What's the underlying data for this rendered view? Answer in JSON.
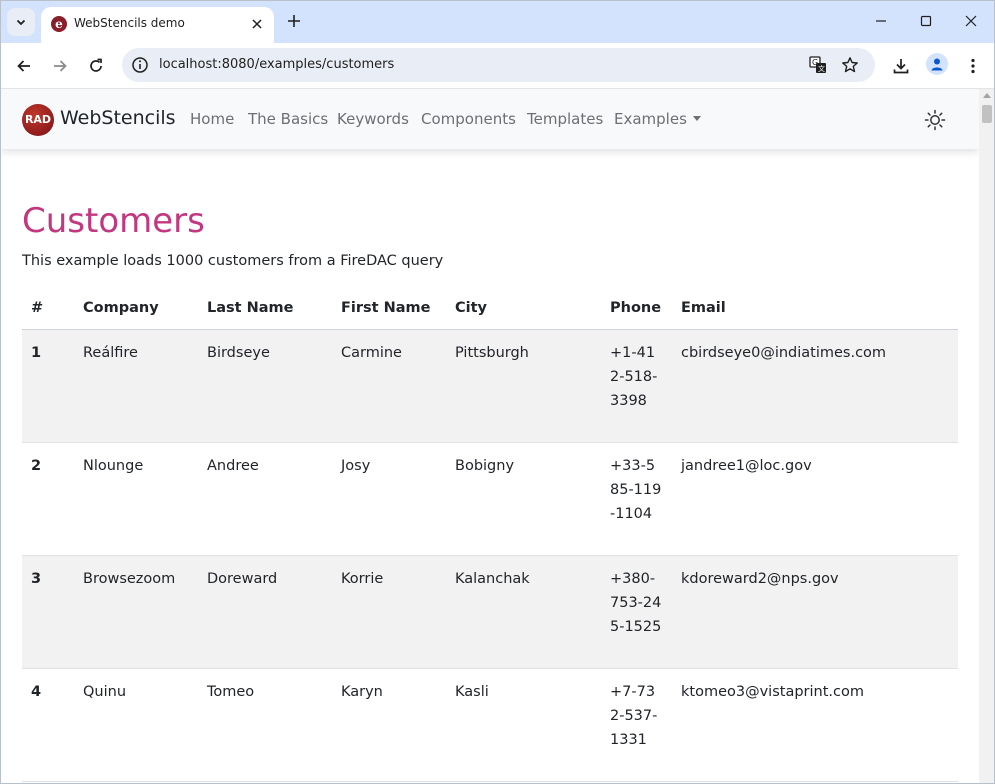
{
  "browser": {
    "tab_title": "WebStencils demo",
    "favicon_letter": "e",
    "url": "localhost:8080/examples/customers"
  },
  "navbar": {
    "logo_text": "RAD",
    "brand": "WebStencils",
    "links": [
      "Home",
      "The Basics",
      "Keywords",
      "Components",
      "Templates",
      "Examples"
    ]
  },
  "page": {
    "title": "Customers",
    "lead": "This example loads 1000 customers from a FireDAC query"
  },
  "table": {
    "headers": [
      "#",
      "Company",
      "Last Name",
      "First Name",
      "City",
      "Phone",
      "Email"
    ],
    "rows": [
      [
        "1",
        "Reálfire",
        "Birdseye",
        "Carmine",
        "Pittsburgh",
        "+1-412-518-3398",
        "cbirdseye0@indiatimes.com"
      ],
      [
        "2",
        "Nlounge",
        "Andree",
        "Josy",
        "Bobigny",
        "+33-585-119-1104",
        "jandree1@loc.gov"
      ],
      [
        "3",
        "Browsezoom",
        "Doreward",
        "Korrie",
        "Kalanchak",
        "+380-753-245-1525",
        "kdoreward2@nps.gov"
      ],
      [
        "4",
        "Quinu",
        "Tomeo",
        "Karyn",
        "Kasli",
        "+7-732-537-1331",
        "ktomeo3@vistaprint.com"
      ]
    ]
  },
  "icons": {
    "tab_search": "chevron-down-icon",
    "tab_close": "close-icon",
    "new_tab": "plus-icon",
    "back": "back-arrow-icon",
    "forward": "forward-arrow-icon",
    "reload": "reload-icon",
    "site_info": "info-icon",
    "translate": "translate-icon",
    "bookmark": "star-icon",
    "download": "download-icon",
    "profile": "profile-icon",
    "menu": "kebab-menu-icon",
    "theme": "sun-icon"
  },
  "colors": {
    "accent_title": "#c2377f",
    "tabstrip": "#d3e3fd",
    "stripe": "#f2f2f2"
  }
}
